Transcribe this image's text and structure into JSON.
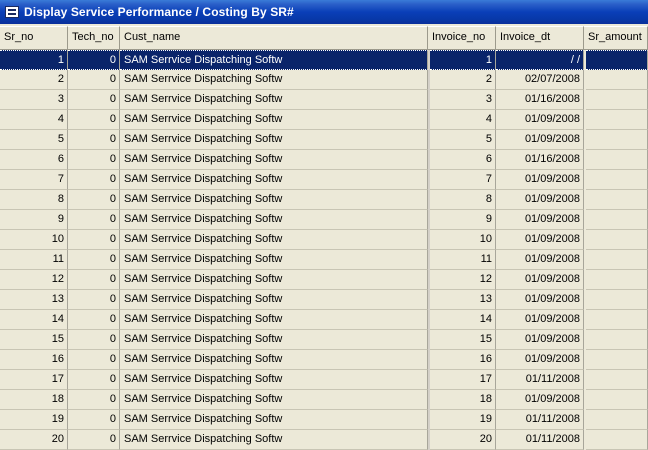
{
  "window": {
    "title": "Display Service Performance / Costing By SR#"
  },
  "columns": [
    "Sr_no",
    "Tech_no",
    "Cust_name",
    "Invoice_no",
    "Invoice_dt",
    "Sr_amount"
  ],
  "rows": [
    {
      "sr_no": "1",
      "tech_no": "0",
      "cust_name": "SAM Serrvice Dispatching Softw",
      "invoice_no": "1",
      "invoice_dt": "/ /",
      "sr_amount": ""
    },
    {
      "sr_no": "2",
      "tech_no": "0",
      "cust_name": "SAM Serrvice Dispatching Softw",
      "invoice_no": "2",
      "invoice_dt": "02/07/2008",
      "sr_amount": ""
    },
    {
      "sr_no": "3",
      "tech_no": "0",
      "cust_name": "SAM Serrvice Dispatching Softw",
      "invoice_no": "3",
      "invoice_dt": "01/16/2008",
      "sr_amount": ""
    },
    {
      "sr_no": "4",
      "tech_no": "0",
      "cust_name": "SAM Serrvice Dispatching Softw",
      "invoice_no": "4",
      "invoice_dt": "01/09/2008",
      "sr_amount": ""
    },
    {
      "sr_no": "5",
      "tech_no": "0",
      "cust_name": "SAM Serrvice Dispatching Softw",
      "invoice_no": "5",
      "invoice_dt": "01/09/2008",
      "sr_amount": ""
    },
    {
      "sr_no": "6",
      "tech_no": "0",
      "cust_name": "SAM Serrvice Dispatching Softw",
      "invoice_no": "6",
      "invoice_dt": "01/16/2008",
      "sr_amount": ""
    },
    {
      "sr_no": "7",
      "tech_no": "0",
      "cust_name": "SAM Serrvice Dispatching Softw",
      "invoice_no": "7",
      "invoice_dt": "01/09/2008",
      "sr_amount": ""
    },
    {
      "sr_no": "8",
      "tech_no": "0",
      "cust_name": "SAM Serrvice Dispatching Softw",
      "invoice_no": "8",
      "invoice_dt": "01/09/2008",
      "sr_amount": ""
    },
    {
      "sr_no": "9",
      "tech_no": "0",
      "cust_name": "SAM Serrvice Dispatching Softw",
      "invoice_no": "9",
      "invoice_dt": "01/09/2008",
      "sr_amount": ""
    },
    {
      "sr_no": "10",
      "tech_no": "0",
      "cust_name": "SAM Serrvice Dispatching Softw",
      "invoice_no": "10",
      "invoice_dt": "01/09/2008",
      "sr_amount": ""
    },
    {
      "sr_no": "11",
      "tech_no": "0",
      "cust_name": "SAM Serrvice Dispatching Softw",
      "invoice_no": "11",
      "invoice_dt": "01/09/2008",
      "sr_amount": ""
    },
    {
      "sr_no": "12",
      "tech_no": "0",
      "cust_name": "SAM Serrvice Dispatching Softw",
      "invoice_no": "12",
      "invoice_dt": "01/09/2008",
      "sr_amount": ""
    },
    {
      "sr_no": "13",
      "tech_no": "0",
      "cust_name": "SAM Serrvice Dispatching Softw",
      "invoice_no": "13",
      "invoice_dt": "01/09/2008",
      "sr_amount": ""
    },
    {
      "sr_no": "14",
      "tech_no": "0",
      "cust_name": "SAM Serrvice Dispatching Softw",
      "invoice_no": "14",
      "invoice_dt": "01/09/2008",
      "sr_amount": ""
    },
    {
      "sr_no": "15",
      "tech_no": "0",
      "cust_name": "SAM Serrvice Dispatching Softw",
      "invoice_no": "15",
      "invoice_dt": "01/09/2008",
      "sr_amount": ""
    },
    {
      "sr_no": "16",
      "tech_no": "0",
      "cust_name": "SAM Serrvice Dispatching Softw",
      "invoice_no": "16",
      "invoice_dt": "01/09/2008",
      "sr_amount": ""
    },
    {
      "sr_no": "17",
      "tech_no": "0",
      "cust_name": "SAM Serrvice Dispatching Softw",
      "invoice_no": "17",
      "invoice_dt": "01/11/2008",
      "sr_amount": ""
    },
    {
      "sr_no": "18",
      "tech_no": "0",
      "cust_name": "SAM Serrvice Dispatching Softw",
      "invoice_no": "18",
      "invoice_dt": "01/09/2008",
      "sr_amount": ""
    },
    {
      "sr_no": "19",
      "tech_no": "0",
      "cust_name": "SAM Serrvice Dispatching Softw",
      "invoice_no": "19",
      "invoice_dt": "01/11/2008",
      "sr_amount": ""
    },
    {
      "sr_no": "20",
      "tech_no": "0",
      "cust_name": "SAM Serrvice Dispatching Softw",
      "invoice_no": "20",
      "invoice_dt": "01/11/2008",
      "sr_amount": ""
    }
  ],
  "selected_row": 0,
  "colors": {
    "selection": "#0a246a",
    "title_bar": "#0a3fb8",
    "grid_bg": "#ece9d8"
  }
}
